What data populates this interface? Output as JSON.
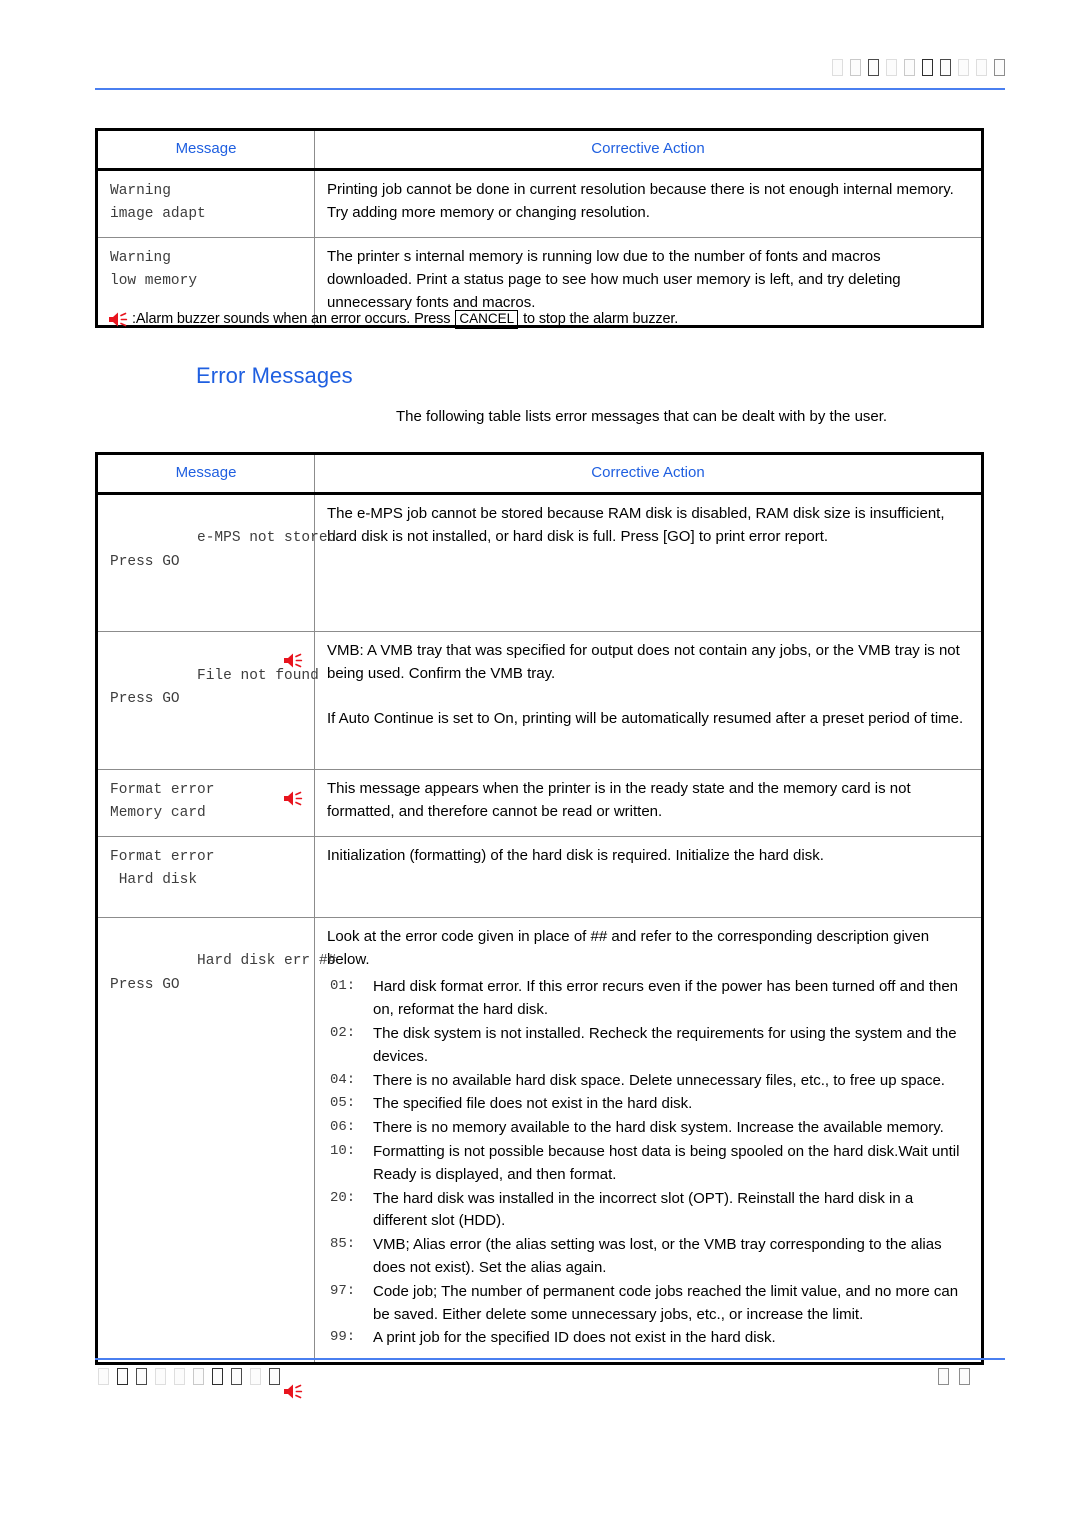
{
  "header": {
    "glyph_count": 10,
    "glyph_shades": [
      "d1",
      "d2",
      "d3",
      "d1",
      "d2",
      "d5",
      "d3",
      "d1",
      "d1",
      "d4"
    ],
    "rule_color": "#4a7ff0"
  },
  "colors": {
    "heading_blue": "#1f5fe0",
    "rule_blue": "#4a7ff0",
    "buzzer_red": "#e8141e",
    "mono_text": "#3d3d3d",
    "table_border": "#000000"
  },
  "table_warning": {
    "columns": [
      "Message",
      "Corrective Action"
    ],
    "rows": [
      {
        "message": "Warning\nimage adapt",
        "has_buzzer": false,
        "paragraphs": [
          "Printing job cannot be done in current resolution because there is not enough internal memory. Try adding more memory or changing resolution."
        ]
      },
      {
        "message": "Warning\nlow memory",
        "has_buzzer": false,
        "paragraphs": [
          "The printer s internal memory is running low due to the number of fonts and macros downloaded. Print a status page to see how much user memory is left, and try deleting unnecessary fonts and macros."
        ]
      }
    ]
  },
  "note": {
    "icon": "alarm-buzzer-icon",
    "text_before": ":Alarm buzzer sounds when an error occurs. Press",
    "key": "CANCEL",
    "text_after": "to stop the alarm buzzer."
  },
  "section": {
    "title": "Error Messages",
    "intro": "The following table lists error messages that can be dealt with by the user."
  },
  "table_error": {
    "columns": [
      "Message",
      "Corrective Action"
    ],
    "rows": [
      {
        "message": "e-MPS not stored\nPress GO",
        "has_buzzer": true,
        "paragraphs": [
          "The e-MPS job cannot be stored because RAM disk is disabled, RAM disk size is insufficient, hard disk is not installed, or hard disk is full. Press [GO] to print error report."
        ]
      },
      {
        "message": "File not found\nPress GO",
        "has_buzzer": true,
        "paragraphs": [
          "VMB: A VMB tray that was specified for output does not contain any jobs, or the VMB tray is not being used. Confirm the VMB tray.",
          "If Auto Continue is set to On, printing will be automatically resumed after a preset period of time."
        ],
        "spacer_before_second": true,
        "mono_token": "On"
      },
      {
        "message": "Format error\nMemory card",
        "has_buzzer": false,
        "paragraphs": [
          "This message appears when the printer is in the ready state and the memory card is not formatted, and therefore cannot be read or written."
        ]
      },
      {
        "message": "Format error\n Hard disk",
        "has_buzzer": false,
        "paragraphs": [
          "Initialization (formatting) of the hard disk is required. Initialize the hard disk."
        ]
      },
      {
        "message": "Hard disk err ##\nPress GO",
        "has_buzzer": true,
        "intro": "Look at the error code given in place of ## and refer to the corresponding description given below.",
        "codes": [
          {
            "code": "01:",
            "text": "Hard disk format error. If this error recurs even if the power has been turned off and then on, reformat the hard disk."
          },
          {
            "code": "02:",
            "text": "The disk system is not installed. Recheck the requirements for using the system and the devices."
          },
          {
            "code": "04:",
            "text": "There is no available hard disk space. Delete unnecessary files, etc., to free up space."
          },
          {
            "code": "05:",
            "text": "The specified file does not exist in the hard disk."
          },
          {
            "code": "06:",
            "text": "There is no memory available to the hard disk system. Increase the available memory."
          },
          {
            "code": "10:",
            "text": "Formatting is not possible because host data is being spooled on the hard disk.Wait until Ready is displayed, and then format."
          },
          {
            "code": "20:",
            "text": "The hard disk was installed in the incorrect slot (OPT). Reinstall the hard disk in a different slot (HDD)."
          },
          {
            "code": "85:",
            "text": "VMB; Alias error (the alias setting was lost, or the VMB tray corresponding to the alias does not exist). Set the alias again."
          },
          {
            "code": "97:",
            "text": "Code job; The number of permanent code jobs reached the limit value, and no more can be saved. Either delete some unnecessary jobs, etc., or increase the limit."
          },
          {
            "code": "99:",
            "text": "A print job for the specified ID does not exist in the hard disk."
          }
        ]
      }
    ]
  },
  "footer": {
    "left_glyph_count": 10,
    "left_glyph_shades": [
      "d1",
      "d5",
      "d3",
      "d1",
      "d1",
      "d2",
      "d5",
      "d3",
      "d1",
      "d3"
    ],
    "right_glyph_count": 2,
    "right_glyph_shades": [
      "d4",
      "d4"
    ],
    "rule_color": "#4a7ff0"
  }
}
